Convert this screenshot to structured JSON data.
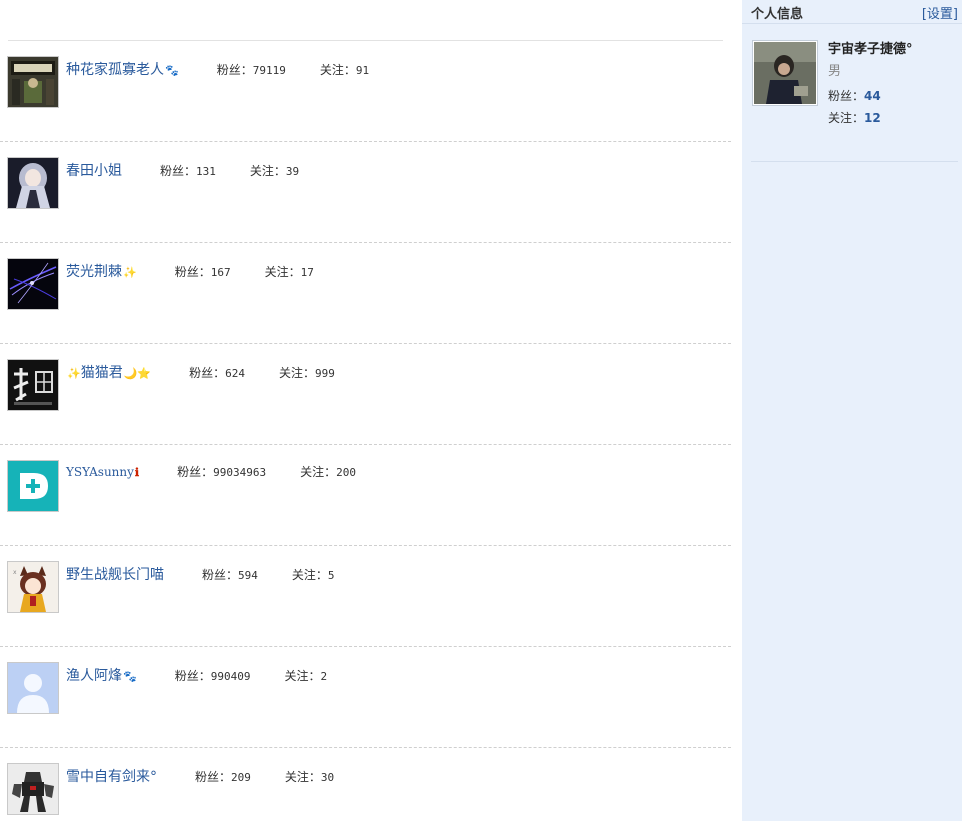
{
  "feed": {
    "fans_label": "粉丝：",
    "follow_label": "关注：",
    "users": [
      {
        "name": "种花家孤寡老人",
        "badge": "paw",
        "fans": "79119",
        "follow": "91",
        "avatar": "sign-shop-icon"
      },
      {
        "name": "春田小姐",
        "badge": "",
        "fans": "131",
        "follow": "39",
        "avatar": "anime-girl-icon"
      },
      {
        "name": "荧光荆棘",
        "badge": "sparkle",
        "fans": "167",
        "follow": "17",
        "avatar": "light-streaks-icon"
      },
      {
        "name": "猫猫君",
        "badge_pre": "sparkle",
        "badge": "moon-star",
        "fans": "624",
        "follow": "999",
        "avatar": "cat-eye-text-icon"
      },
      {
        "name": "YSYAsunny",
        "badge": "info",
        "fans": "99034963",
        "follow": "200",
        "avatar": "teal-d-plus-logo-icon"
      },
      {
        "name": "野生战舰长门喵",
        "badge": "",
        "fans": "594",
        "follow": "5",
        "avatar": "anime-catgirl-icon"
      },
      {
        "name": "渔人阿烽",
        "badge": "paw",
        "fans": "990409",
        "follow": "2",
        "avatar": "default-person-icon"
      },
      {
        "name": "雪中自有剑来°",
        "badge": "",
        "fans": "209",
        "follow": "30",
        "avatar": "mecha-robot-icon"
      }
    ]
  },
  "sidebar": {
    "title": "个人信息",
    "settings": "[设置]",
    "me": {
      "name": "宇宙孝子捷德°",
      "gender": "男",
      "fans_label": "粉丝：",
      "fans": "44",
      "follow_label": "关注：",
      "follow": "12"
    }
  },
  "colors": {
    "link": "#2a5a9c",
    "sidebar_bg": "#e8f0fb",
    "separator": "#cfcfcf"
  }
}
